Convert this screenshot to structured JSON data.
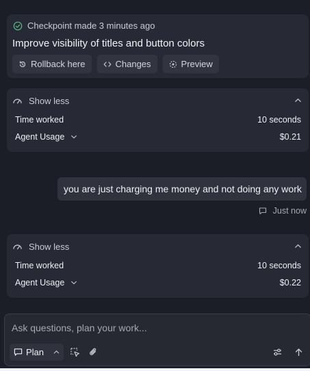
{
  "checkpoint": {
    "status": "Checkpoint made 3 minutes ago",
    "title": "Improve visibility of titles and button colors",
    "actions": [
      {
        "label": "Rollback here",
        "icon": "rollback-icon"
      },
      {
        "label": "Changes",
        "icon": "code-icon"
      },
      {
        "label": "Preview",
        "icon": "preview-icon"
      }
    ]
  },
  "usage_cards": [
    {
      "toggle_label": "Show less",
      "time_label": "Time worked",
      "time_value": "10 seconds",
      "usage_label": "Agent Usage",
      "usage_value": "$0.21"
    },
    {
      "toggle_label": "Show less",
      "time_label": "Time worked",
      "time_value": "10 seconds",
      "usage_label": "Agent Usage",
      "usage_value": "$0.22"
    }
  ],
  "user_message": {
    "text": "you are just charging me money and not doing any work",
    "timestamp": "Just now"
  },
  "composer": {
    "placeholder": "Ask questions, plan your work...",
    "mode_label": "Plan"
  },
  "colors": {
    "background": "#1b1e27",
    "card": "#272a34",
    "check_green": "#4fbf7f"
  }
}
